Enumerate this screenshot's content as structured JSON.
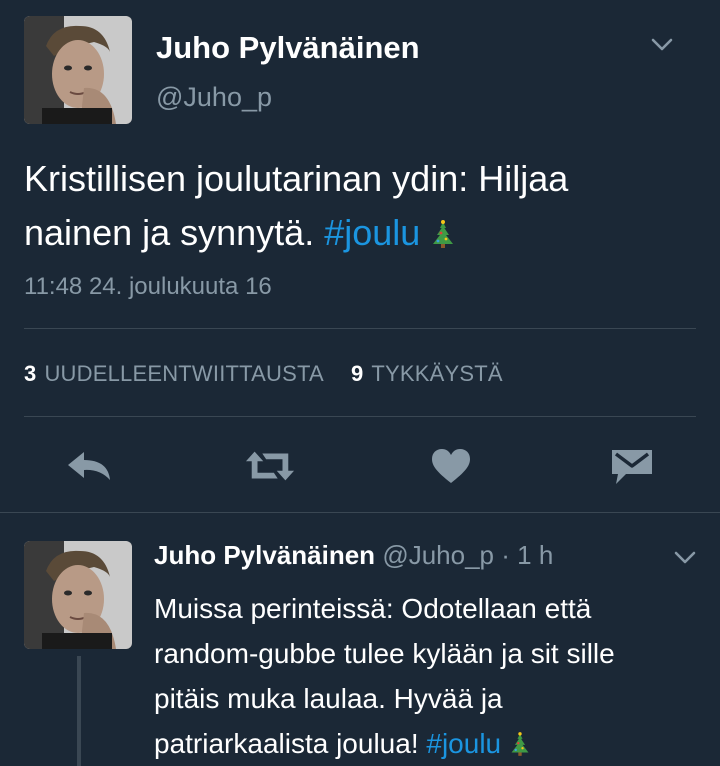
{
  "tweet": {
    "author_name": "Juho Pylvänäinen",
    "author_handle": "@Juho_p",
    "text_line1": "Kristillisen joulutarinan ydin: Hiljaa",
    "text_line2": "nainen ja synnytä.",
    "hashtag": "#joulu",
    "emoji": "christmas-tree",
    "timestamp": "11:48 24. joulukuuta 16",
    "retweet_count": "3",
    "retweet_label": "UUDELLEENTWIITTAUSTA",
    "like_count": "9",
    "like_label": "TYKKÄYSTÄ"
  },
  "actions": [
    "reply-icon",
    "retweet-icon",
    "like-icon",
    "direct-message-icon"
  ],
  "reply": {
    "author_name": "Juho Pylvänäinen",
    "author_handle": "@Juho_p",
    "time": "· 1 h",
    "line1": "Muissa perinteissä: Odotellaan että",
    "line2": "random-gubbe tulee kylään ja sit sille",
    "line3": "pitäis muka laulaa. Hyvää ja",
    "line4": "patriarkaalista joulua!",
    "hashtag": "#joulu",
    "emoji": "christmas-tree"
  },
  "colors": {
    "background": "#1b2836",
    "secondary_text": "#8899a6",
    "hashtag": "#1b95e0",
    "divider": "#3a4753"
  }
}
